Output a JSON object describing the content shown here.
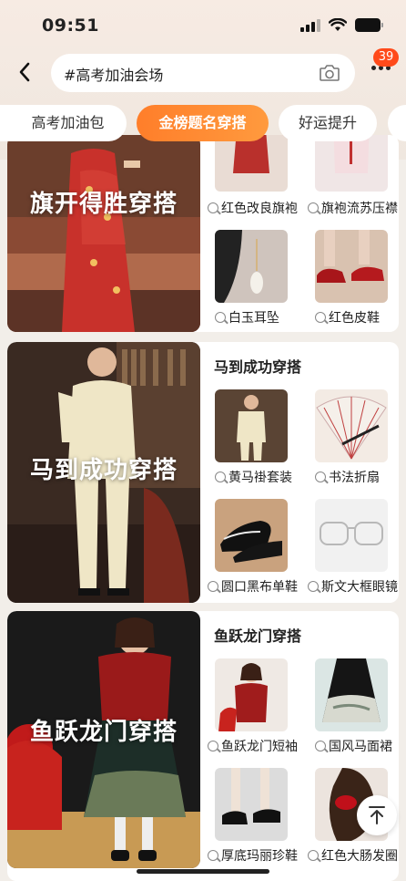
{
  "status": {
    "time": "09:51"
  },
  "search": {
    "query": "#高考加油会场"
  },
  "notifications": {
    "count": "39"
  },
  "tabs": [
    {
      "label": "高考加油包"
    },
    {
      "label": "金榜题名穿搭",
      "active": true
    },
    {
      "label": "好运提升"
    }
  ],
  "sections": [
    {
      "hero_title": "旗开得胜穿搭",
      "products": [
        {
          "label": "红色改良旗袍"
        },
        {
          "label": "旗袍流苏压襟"
        },
        {
          "label": "白玉耳坠"
        },
        {
          "label": "红色皮鞋"
        }
      ]
    },
    {
      "hero_title": "马到成功穿搭",
      "title": "马到成功穿搭",
      "products": [
        {
          "label": "黄马褂套装"
        },
        {
          "label": "书法折扇"
        },
        {
          "label": "圆口黑布单鞋"
        },
        {
          "label": "斯文大框眼镜"
        }
      ]
    },
    {
      "hero_title": "鱼跃龙门穿搭",
      "title": "鱼跃龙门穿搭",
      "products": [
        {
          "label": "鱼跃龙门短袖"
        },
        {
          "label": "国风马面裙"
        },
        {
          "label": "厚底玛丽珍鞋"
        },
        {
          "label": "红色大肠发圈"
        }
      ]
    }
  ],
  "colors": {
    "accent": "#ff7e2a",
    "badge": "#ff4a1a",
    "background": "#f2eee9"
  },
  "icons": [
    "back-arrow-icon",
    "camera-icon",
    "more-icon",
    "search-icon",
    "scroll-top-icon"
  ]
}
